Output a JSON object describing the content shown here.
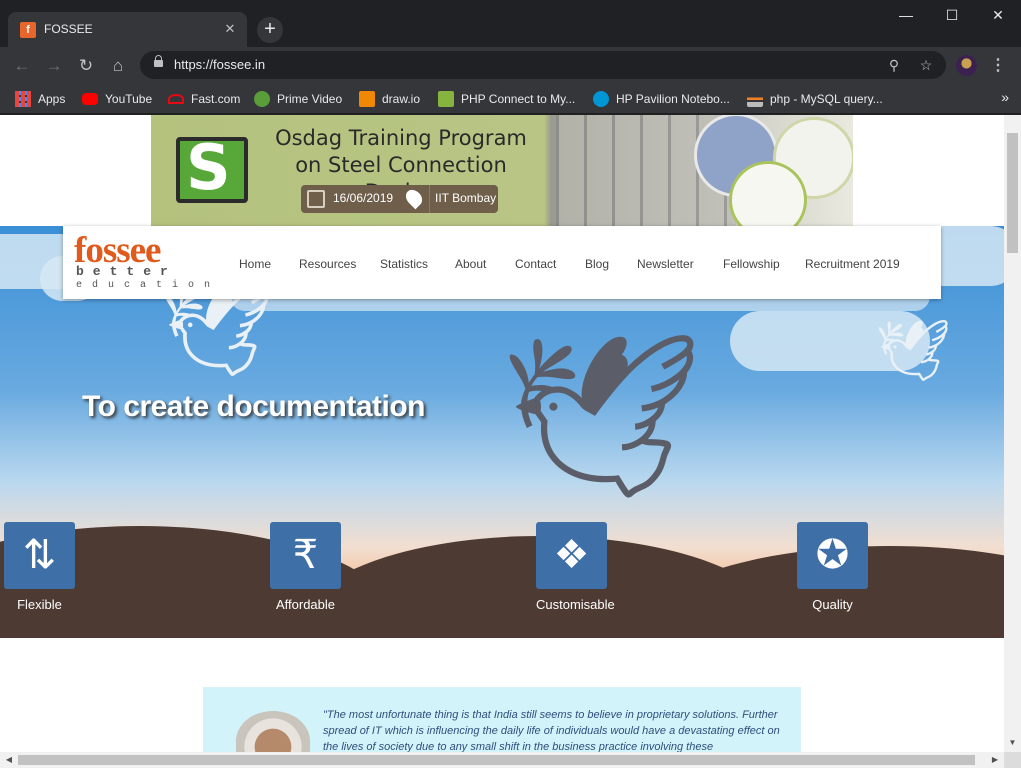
{
  "browser": {
    "tab": {
      "title": "FOSSEE",
      "favicon": "f"
    },
    "new_tab_symbol": "+",
    "url": "https://fossee.in",
    "bookmarks": [
      {
        "label": "Apps",
        "color": "#e8453c"
      },
      {
        "label": "YouTube",
        "color": "#ff0000"
      },
      {
        "label": "Fast.com",
        "color": "#e50914"
      },
      {
        "label": "Prime Video",
        "color": "#5a9e3a"
      },
      {
        "label": "draw.io",
        "color": "#f08705"
      },
      {
        "label": "PHP Connect to My...",
        "color": "#86b43f"
      },
      {
        "label": "HP Pavilion Notebo...",
        "color": "#0096d6"
      },
      {
        "label": "php - MySQL query...",
        "color": "#f48024"
      }
    ]
  },
  "banner": {
    "title_line1": "Osdag Training Program",
    "title_line2": "on Steel Connection Design",
    "date": "16/06/2019",
    "place": "IIT Bombay",
    "logo_letter": "S"
  },
  "logo": {
    "main": "fossee",
    "sub": "better",
    "sub2": "education"
  },
  "nav": [
    "Home",
    "Resources",
    "Statistics",
    "About",
    "Contact",
    "Blog",
    "Newsletter",
    "Fellowship",
    "Recruitment 2019"
  ],
  "hero": {
    "headline": "To create documentation"
  },
  "features": [
    {
      "label": "Flexible",
      "icon": "split-arrows-icon"
    },
    {
      "label": "Affordable",
      "icon": "rupee-icon"
    },
    {
      "label": "Customisable",
      "icon": "puzzle-icon"
    },
    {
      "label": "Quality",
      "icon": "award-badge-icon"
    }
  ],
  "quote": {
    "text": "\"The most unfortunate thing is that India still seems to believe in proprietary solutions. Further spread of IT which is influencing the daily life of individuals would have a devastating effect on the lives of society due to any small shift in the business practice involving these"
  },
  "colors": {
    "accent": "#e05a1e",
    "tile": "#3e6fa7",
    "quote_bg": "#d3f3fb"
  }
}
